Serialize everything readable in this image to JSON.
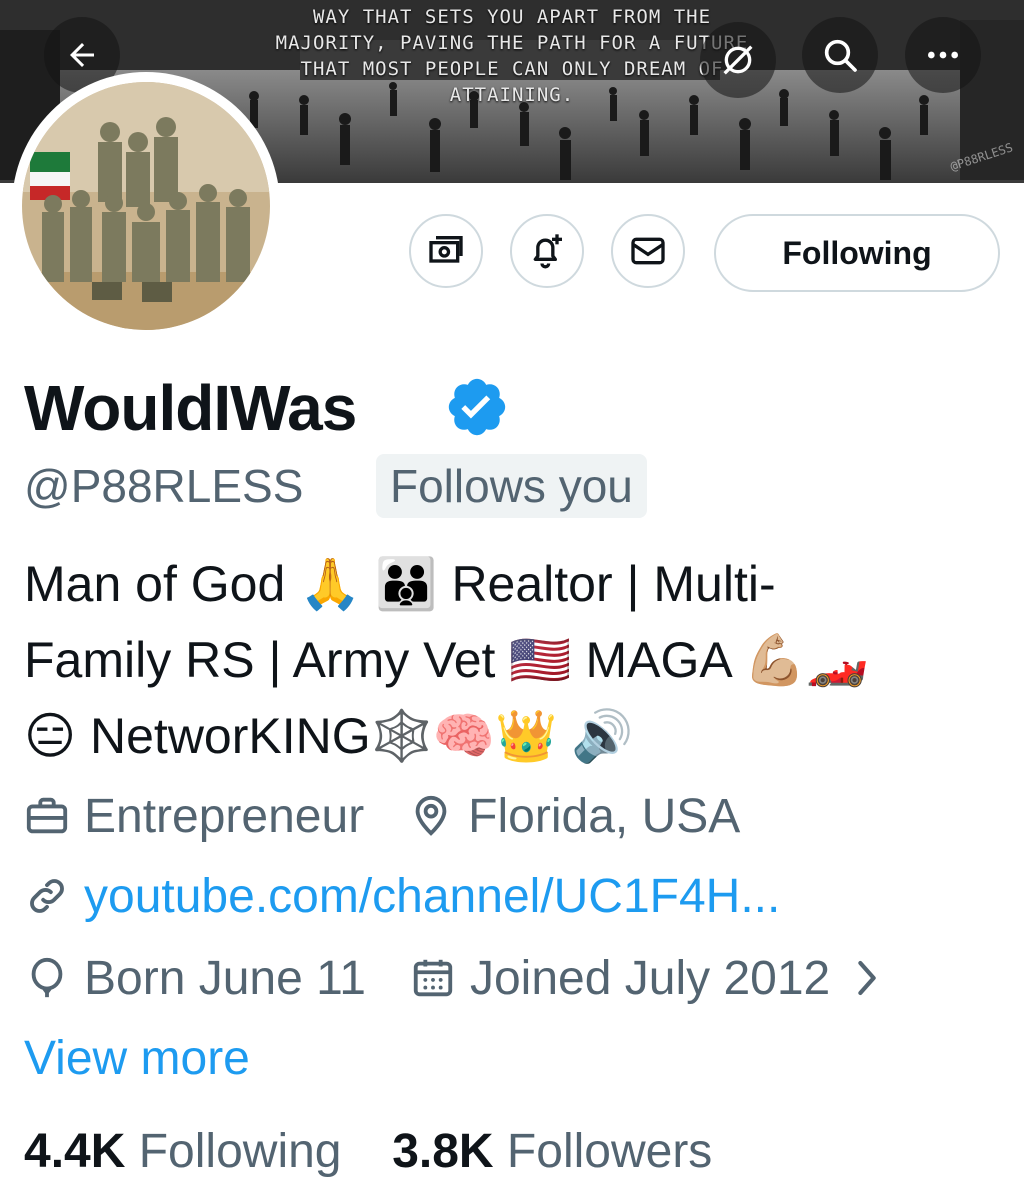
{
  "banner": {
    "quote_lines": [
      "WAY THAT SETS YOU APART FROM THE",
      "MAJORITY, PAVING THE PATH FOR A FUTURE",
      "THAT MOST PEOPLE CAN ONLY DREAM OF",
      "ATTAINING."
    ],
    "watermark": "@P88RLESS"
  },
  "header_buttons": {
    "back": "arrow-left-icon",
    "grok": "grok-icon",
    "search": "search-icon",
    "more": "more-icon"
  },
  "actions": {
    "tip": "tip-icon",
    "notify": "bell-plus-icon",
    "message": "envelope-icon",
    "following_label": "Following"
  },
  "profile": {
    "display_name": "WouldIWas",
    "verified": true,
    "verified_color": "#1d9bf0",
    "handle": "@P88RLESS",
    "follows_you_label": "Follows you",
    "bio_lines": [
      "Man of God 🙏 👪 Realtor | Multi-",
      "Family RS | Army Vet 🇺🇸 MAGA 💪🏼🏎️",
      "😑 NetworKING🕸️🧠👑 🔊"
    ],
    "profession": "Entrepreneur",
    "location": "Florida, USA",
    "website": "youtube.com/channel/UC1F4H...",
    "birthday": "Born June 11",
    "joined": "Joined July 2012",
    "view_more": "View more"
  },
  "stats": {
    "following_count": "4.4K",
    "following_label": "Following",
    "followers_count": "3.8K",
    "followers_label": "Followers"
  },
  "colors": {
    "accent": "#1d9bf0",
    "secondary_text": "#536471",
    "primary_text": "#0f1419",
    "border": "#cfd9de"
  }
}
